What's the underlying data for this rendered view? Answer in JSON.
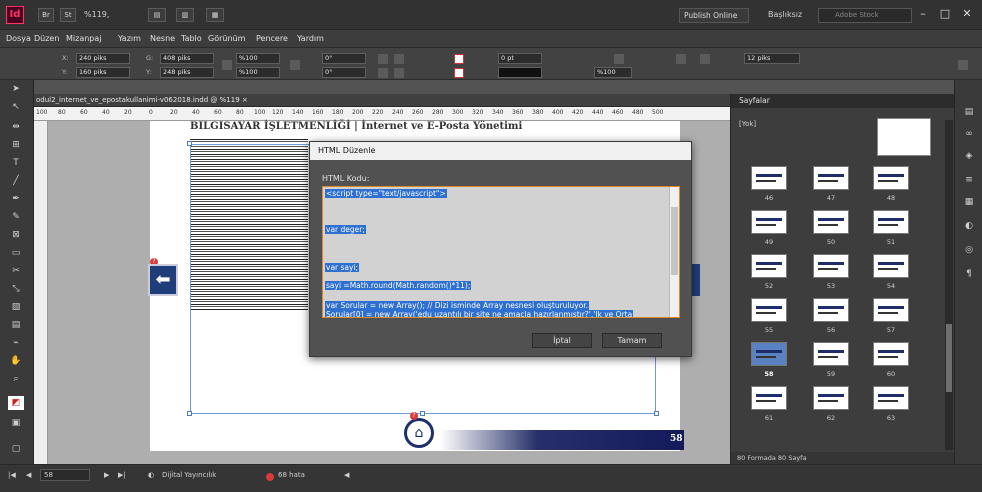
{
  "app": {
    "logo": "Id",
    "title_tabs": [
      "Br",
      "St"
    ],
    "zoom": "%119,",
    "publish": "Publish Online",
    "workspace": "Başlıksız",
    "stock_placeholder": "Adobe Stock"
  },
  "window": {
    "minimize": "–",
    "maximize": "□",
    "close": "✕"
  },
  "menu": [
    "Dosya",
    "Düzen",
    "Mizanpaj",
    "Yazım",
    "Nesne",
    "Tablo",
    "Görünüm",
    "Pencere",
    "Yardım"
  ],
  "control": {
    "x": "240 piks",
    "y": "160 piks",
    "w": "408 piks",
    "h": "248 piks",
    "scale_x": "%100",
    "scale_y": "%100",
    "angle": "0°",
    "shear": "0°",
    "stroke": "0 pt",
    "opacity": "%100",
    "gutter": "12 piks"
  },
  "document": {
    "tab": "odul2_internet_ve_epostakullanimi-v062018.indd @ %119",
    "page_heading": "BILGISAYAR İŞLETMENLİĞİ | İnternet ve E-Posta Yönetimi",
    "page_number": "58",
    "ruler_ticks": [
      "100",
      "80",
      "60",
      "40",
      "20",
      "0",
      "20",
      "40",
      "60",
      "80",
      "100",
      "120",
      "140",
      "160",
      "180",
      "200",
      "220",
      "240",
      "260",
      "280",
      "300",
      "320",
      "340",
      "360",
      "380",
      "400",
      "420",
      "440",
      "460",
      "480",
      "500"
    ]
  },
  "dialog": {
    "title": "HTML Düzenle",
    "label": "HTML Kodu:",
    "code_lines": [
      "<script type=\"text/javascript\">",
      "var deger;",
      "var sayi;",
      "sayi =Math.round(Math.random()*11);",
      "var Sorular = new Array(); // Dizi isminde Array nesnesi oluşturuluyor.",
      "Sorular[0] = new Array('edu uzantılı bir site ne amaçla hazırlanmıştır?','Ik ve Orta"
    ],
    "cancel": "İptal",
    "ok": "Tamam"
  },
  "pages_panel": {
    "title": "Sayfalar",
    "master": "[Yok]",
    "page_numbers": [
      "46",
      "47",
      "48",
      "49",
      "50",
      "51",
      "52",
      "53",
      "54",
      "55",
      "56",
      "57",
      "58",
      "59",
      "60",
      "61",
      "62",
      "63"
    ],
    "selected_page": "58",
    "footer": "80 Formada 80 Sayfa"
  },
  "status": {
    "page": "58",
    "profile": "Dijital Yayıncılık",
    "errors": "68 hata"
  },
  "icons": {
    "tools": [
      "selection-icon",
      "direct-selection-icon",
      "page-tool-icon",
      "gap-tool-icon",
      "type-icon",
      "line-icon",
      "pen-icon",
      "pencil-icon",
      "frame-icon",
      "rectangle-icon",
      "scissors-icon",
      "transform-icon",
      "gradient-icon",
      "note-icon",
      "eyedropper-icon",
      "hand-icon",
      "zoom-icon"
    ]
  },
  "colors": {
    "accent": "#2e6fd2",
    "brand": "#ff3366",
    "panel": "#3d3d3d"
  }
}
